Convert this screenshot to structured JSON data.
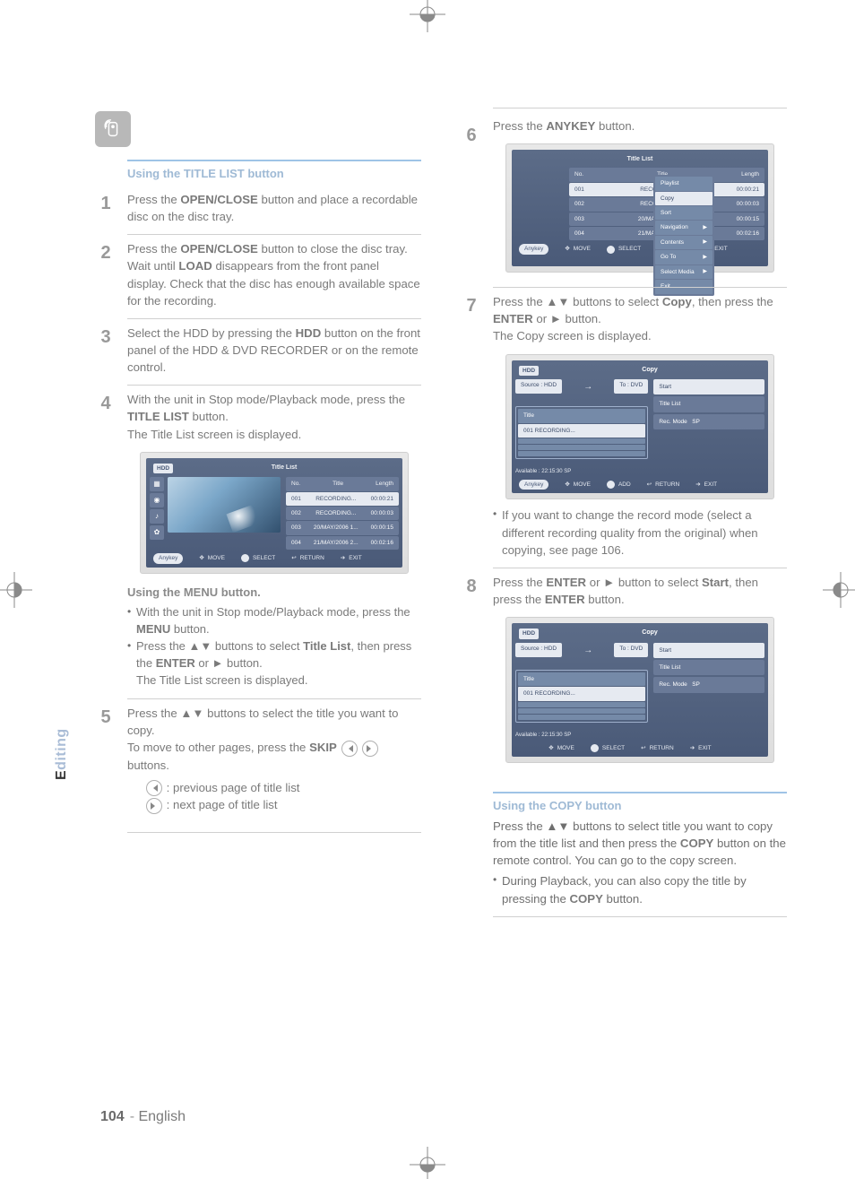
{
  "page": {
    "number": "104",
    "language": "English",
    "sideTab": "Editing"
  },
  "box": {
    "heading": "Using the TITLE LIST button"
  },
  "stepsL": {
    "s1": {
      "num": "1",
      "a": "Press the ",
      "btn": "OPEN/CLOSE",
      "b": " button and place a recordable disc on the disc tray."
    },
    "s2": {
      "num": "2",
      "a": " Press the ",
      "btn": "OPEN/CLOSE",
      "b": " button to close the disc tray. Wait until ",
      "btn2": "LOAD",
      "c": " disappears from the front panel display. Check that the disc has enough available space for the recording."
    },
    "s3": {
      "num": "3",
      "a": "Select the HDD by pressing the ",
      "btn": "HDD",
      "b": " button on the front panel of the HDD & DVD RECORDER or on the remote control."
    },
    "s4": {
      "num": "4",
      "a": "With the unit in Stop mode/Playback mode, press the ",
      "btn": "TITLE LIST",
      "b": " button.",
      "c": "The Title List screen is displayed."
    },
    "menuHeading": "Using the MENU button.",
    "menu1a": "With the unit in Stop mode/Playback mode, press the ",
    "menu1btn": "MENU",
    "menu1b": " button.",
    "menu2a": "Press the ▲▼ buttons to select ",
    "menu2sel": "Title List",
    "menu2b": ", then press the ",
    "menu2btn": "ENTER",
    "menu2c": " or ► button.",
    "menu2d": "The Title List screen is displayed.",
    "s5": {
      "num": "5",
      "a": "Press the ▲▼ buttons to select the title you want to copy.",
      "b": "To move to other pages, press the ",
      "btn": "SKIP",
      "c": " buttons.",
      "d": " : previous page of title list",
      "e": " : next page of title list"
    }
  },
  "stepsR": {
    "s6": {
      "num": "6",
      "a": "Press the ",
      "btn": "ANYKEY",
      "b": " button."
    },
    "s7": {
      "num": "7",
      "a": "Press the ▲▼ buttons to select ",
      "sel": "Copy",
      "b": ", then press the ",
      "btn": "ENTER",
      "c": " or ► button.",
      "d": "The Copy screen is displayed."
    },
    "note7": "If you want to change the record mode (select a different recording quality from the original) when copying, see page 106.",
    "s8": {
      "num": "8",
      "a": "Press the ",
      "btn": "ENTER",
      "b": " or ► button to select ",
      "sel": "Start",
      "c": ", then press the ",
      "btn2": "ENTER",
      "d": " button."
    },
    "copyBox": {
      "heading": "Using the COPY button",
      "line1a": "Press the ▲▼ buttons to select title you want to copy from the title list and then press the ",
      "line1btn": "COPY",
      "line1b": " button on the remote control. You can go to the copy screen.",
      "line2a": "During Playback, you can also copy the title by pressing the ",
      "line2btn": "COPY",
      "line2b": " button."
    }
  },
  "osd": {
    "screenTag": "HDD",
    "titleList": "Title List",
    "rowsTitle": [
      {
        "no": "No.",
        "title": "Title",
        "len": "Length"
      },
      {
        "no": "001",
        "title": "RECORDING...",
        "len": "00:00:21"
      },
      {
        "no": "002",
        "title": "RECORDING...",
        "len": "00:00:03"
      },
      {
        "no": "003",
        "title": "20/MAY/2006 1...",
        "len": "00:00:15"
      },
      {
        "no": "004",
        "title": "21/MAY/2006 2...",
        "len": "00:02:16"
      }
    ],
    "copyTitle": "Copy",
    "sourceLabel": "Source : HDD",
    "destLabel": "To : DVD",
    "timeAvail": "Available : 22:15:30 SP",
    "selItem": "001 RECORDING...",
    "mode": "Rec. Mode",
    "modeVal": "SP",
    "actions": [
      "Start",
      "Title List",
      "Rec. Mode"
    ],
    "popup": [
      "Playlist",
      "Copy",
      "Sort",
      "Navigation",
      "Contents",
      "Go To",
      "Select Media",
      "Exit"
    ],
    "footer": {
      "anykey": "Anykey",
      "move": "MOVE",
      "select": "SELECT",
      "return": "RETURN",
      "exit": "EXIT",
      "add": "ADD"
    }
  }
}
